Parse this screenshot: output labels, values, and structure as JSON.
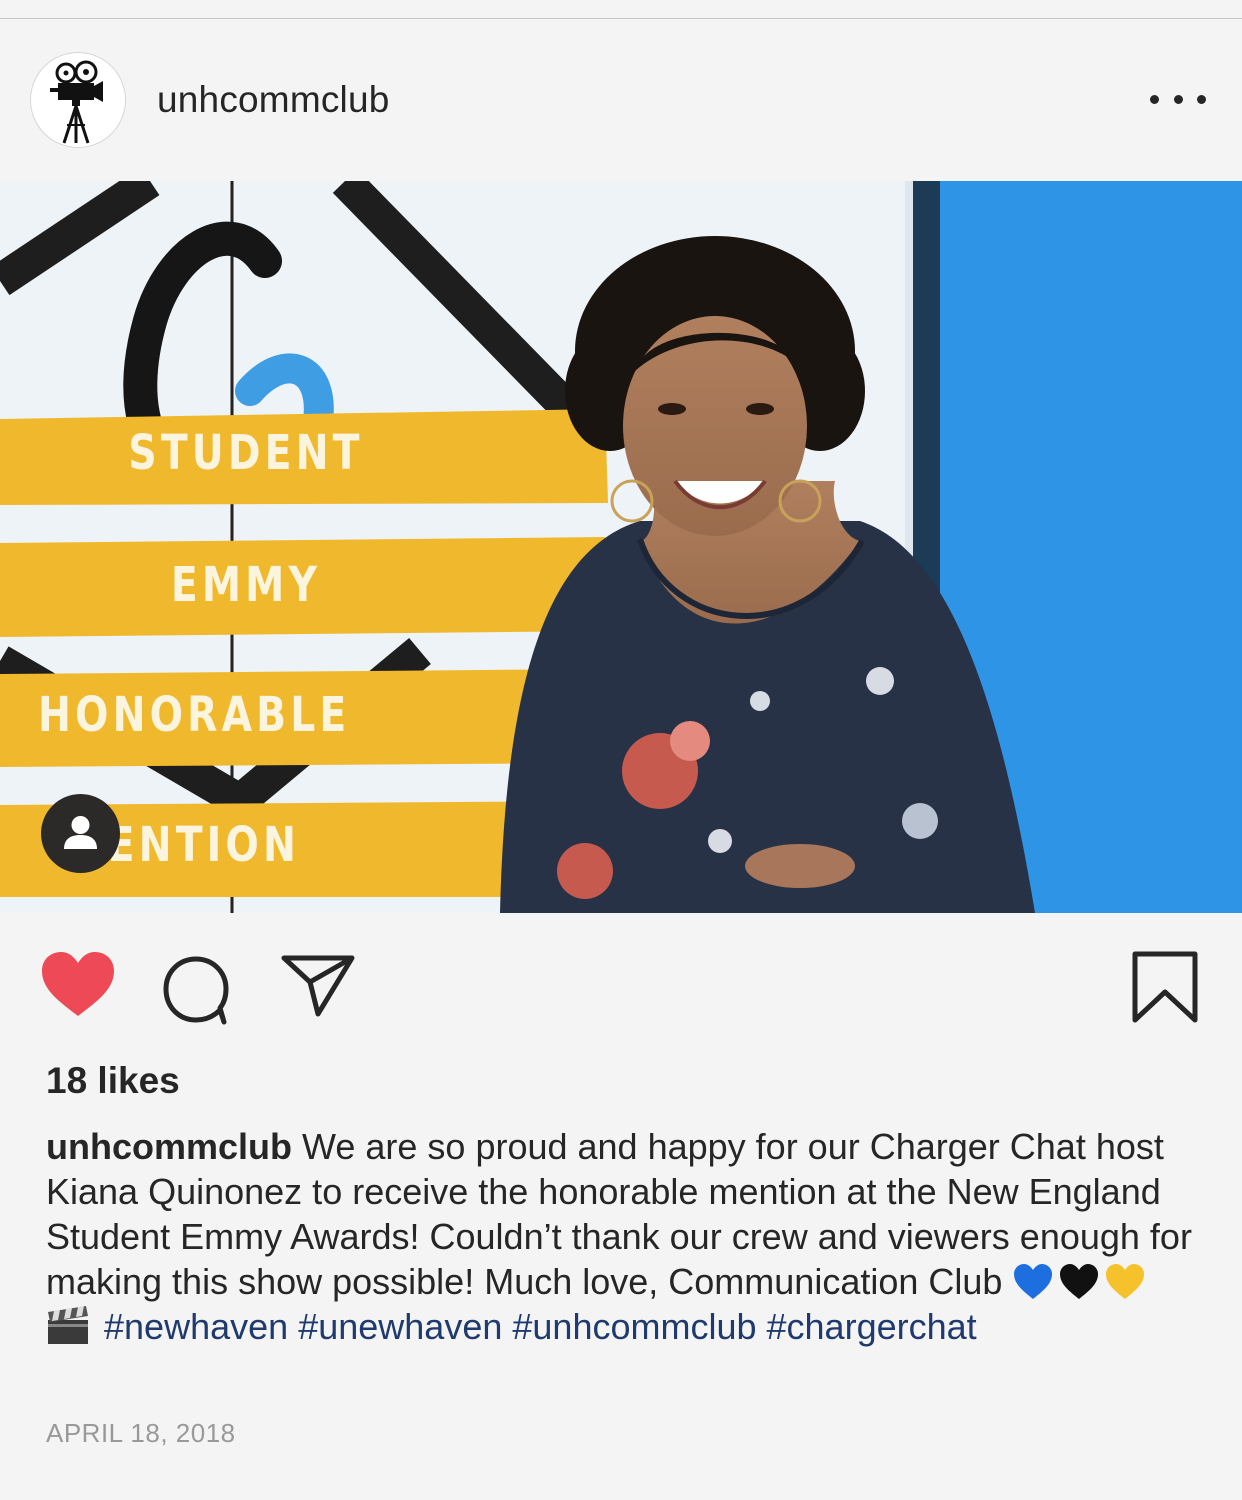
{
  "post": {
    "username": "unhcommclub",
    "avatar_icon": "film-camera-tripod-icon",
    "more_icon": "more-dots-icon",
    "image": {
      "band_lines": [
        "STUDENT",
        "EMMY",
        "HONORABLE",
        "MENTION"
      ],
      "band_color": "#f0b82d",
      "backdrop_blue": "#2e95e6",
      "tag_icon": "user-tag-icon"
    },
    "actions": {
      "like_icon": "heart-filled-icon",
      "like_color": "#ed4956",
      "comment_icon": "comment-icon",
      "share_icon": "send-paper-plane-icon",
      "save_icon": "bookmark-icon"
    },
    "likes": "18 likes",
    "caption": {
      "username": "unhcommclub",
      "text": "We are so proud and happy for our Charger Chat host Kiana Quinonez to receive the honorable mention at the New England Student Emmy Awards! Couldn’t thank our crew and viewers enough for making this show possible! Much love, Communication Club",
      "emojis": [
        "blue-heart-emoji",
        "black-heart-emoji",
        "yellow-heart-emoji",
        "clapper-board-emoji"
      ],
      "hashtags": [
        "#newhaven",
        "#unewhaven",
        "#unhcommclub",
        "#chargerchat"
      ]
    },
    "date": "APRIL 18, 2018"
  }
}
